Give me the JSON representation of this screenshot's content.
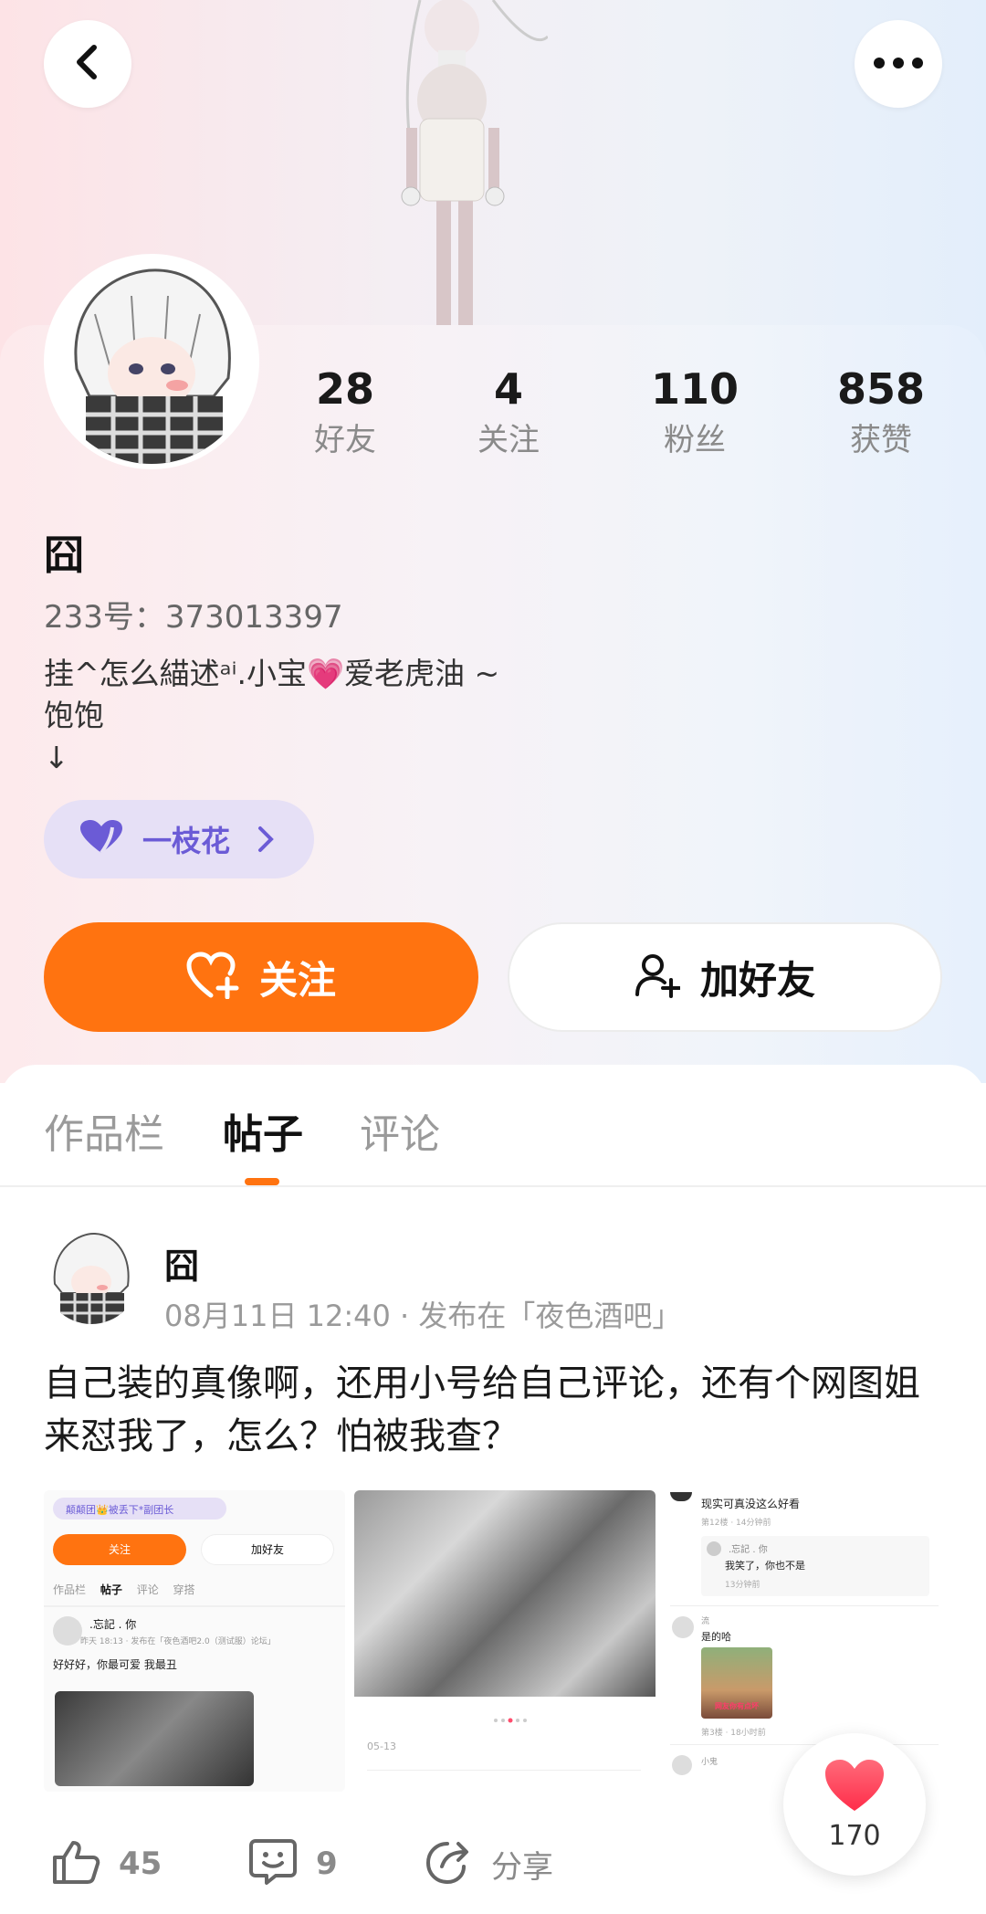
{
  "header": {
    "back_icon": "chevron-left-icon",
    "more_icon": "more-dots-icon"
  },
  "profile": {
    "stats": [
      {
        "value": "28",
        "label": "好友"
      },
      {
        "value": "4",
        "label": "关注"
      },
      {
        "value": "110",
        "label": "粉丝"
      },
      {
        "value": "858",
        "label": "获赞"
      }
    ],
    "name": "囧",
    "id_line": "233号：373013397",
    "bio_lines": [
      "挂^怎么緢述ᵃⁱ.小宝💗爱老虎油 ~",
      "饱饱",
      "↓"
    ],
    "tag_label": "一枝花",
    "follow_label": "关注",
    "add_friend_label": "加好友"
  },
  "tabs": [
    {
      "label": "作品栏",
      "active": false
    },
    {
      "label": "帖子",
      "active": true
    },
    {
      "label": "评论",
      "active": false
    }
  ],
  "post": {
    "author": "囧",
    "meta": "08月11日 12:40 · 发布在「夜色酒吧」",
    "text": "自己装的真像啊，还用小号给自己评论，还有个网图姐来怼我了，怎么？怕被我查？",
    "thumb1": {
      "pill": "颠颠团👑被丢下*副团长",
      "follow": "关注",
      "add_friend": "加好友",
      "tabs": [
        "作品栏",
        "帖子",
        "评论",
        "穿搭"
      ],
      "user": ".忘記 . 你",
      "meta": "昨天 18:13 · 发布在「夜色酒吧2.0（测试服）论坛」",
      "text": "好好好，你最可爱 我最丑"
    },
    "thumb2": {
      "date": "05-13"
    },
    "thumb3": {
      "c1": "现实可真没这么好看",
      "c1_meta": "第12楼 · 14分钟前",
      "reply_user": ".忘記 . 你",
      "reply_text": "我笑了，你也不是",
      "reply_meta": "13分钟前",
      "c2_user": "流",
      "c2_text": "是的哈",
      "c2_img_text": "网友你有点坏",
      "c2_meta": "第3楼 · 18小时前",
      "c3_user": "小鬼"
    },
    "likes": "45",
    "comments": "9",
    "share_label": "分享",
    "float_likes": "170"
  },
  "colors": {
    "accent": "#ff7310",
    "tag_bg": "#e6e0f6",
    "tag_text": "#6b5bd6"
  }
}
